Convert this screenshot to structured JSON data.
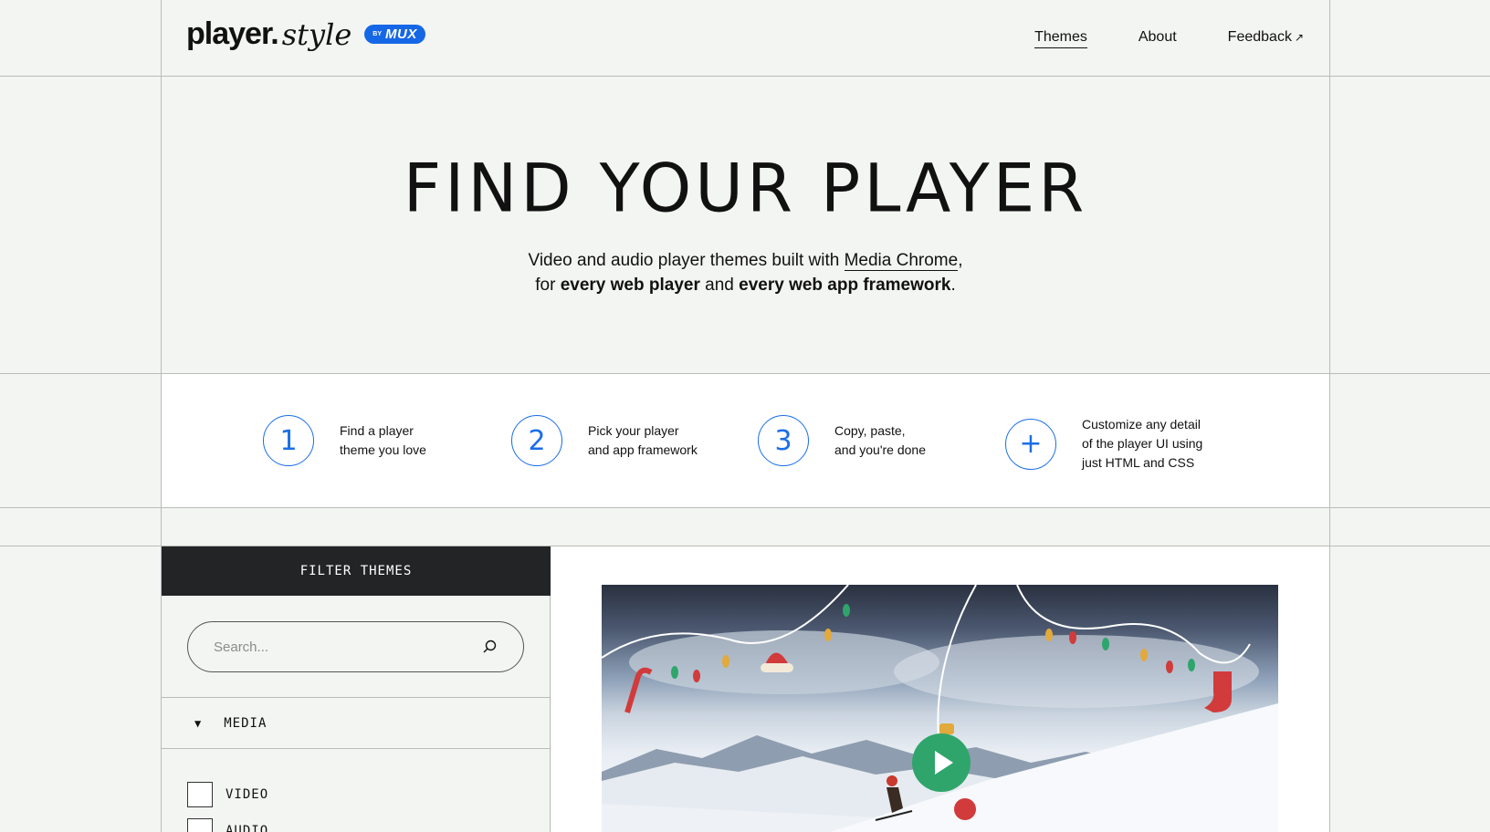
{
  "header": {
    "logo_main": "player.",
    "logo_style": "style",
    "badge_by": "BY",
    "badge_name": "MUX",
    "nav": [
      {
        "label": "Themes",
        "active": true
      },
      {
        "label": "About",
        "active": false
      },
      {
        "label": "Feedback",
        "external": true
      }
    ],
    "external_arrow": "↗"
  },
  "hero": {
    "title": "FIND YOUR PLAYER",
    "sub_line1_pre": "Video and audio player themes built with ",
    "sub_line1_link": "Media Chrome",
    "sub_line1_post": ",",
    "sub_line2_pre": "for ",
    "sub_line2_b1": "every web player",
    "sub_line2_mid": " and ",
    "sub_line2_b2": "every web app framework",
    "sub_line2_post": "."
  },
  "steps": [
    {
      "marker": "1",
      "line1": "Find a player",
      "line2": "theme you love",
      "line3": ""
    },
    {
      "marker": "2",
      "line1": "Pick your player",
      "line2": "and app framework",
      "line3": ""
    },
    {
      "marker": "3",
      "line1": "Copy, paste,",
      "line2": "and you're done",
      "line3": ""
    },
    {
      "marker": "+",
      "line1": "Customize any detail",
      "line2": "of the player UI using",
      "line3": "just HTML and CSS"
    }
  ],
  "filter": {
    "heading": "FILTER THEMES",
    "search_placeholder": "Search...",
    "search_value": "",
    "group_label": "MEDIA",
    "group_toggle": "▼",
    "options": [
      {
        "label": "VIDEO",
        "checked": false
      },
      {
        "label": "AUDIO",
        "checked": false
      }
    ]
  },
  "colors": {
    "accent": "#1a6ee8",
    "mux_badge": "#1667e6",
    "filter_header": "#222426",
    "background": "#f3f5f2",
    "play_button": "#2fa56b"
  },
  "icons": {
    "search": "search-icon",
    "external": "external-link-icon",
    "play": "play-icon"
  }
}
